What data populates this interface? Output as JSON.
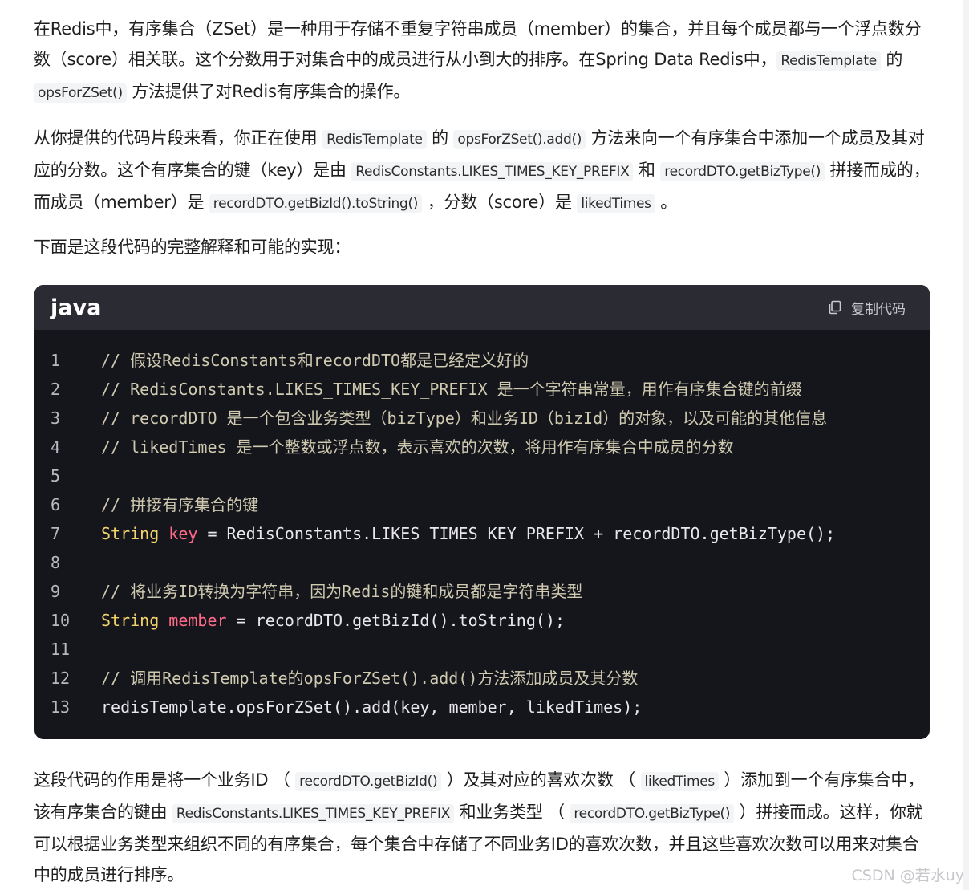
{
  "intro": {
    "p1": {
      "t1": "在Redis中，有序集合（ZSet）是一种用于存储不重复字符串成员（member）的集合，并且每个成员都与一个浮点数分数（score）相关联。这个分数用于对集合中的成员进行从小到大的排序。在Spring Data Redis中，",
      "c1": "RedisTemplate",
      "t2": " 的 ",
      "c2": "opsForZSet()",
      "t3": " 方法提供了对Redis有序集合的操作。"
    },
    "p2": {
      "t1": "从你提供的代码片段来看，你正在使用 ",
      "c1": "RedisTemplate",
      "t2": " 的 ",
      "c2": "opsForZSet().add()",
      "t3": " 方法来向一个有序集合中添加一个成员及其对应的分数。这个有序集合的键（key）是由 ",
      "c3": "RedisConstants.LIKES_TIMES_KEY_PREFIX",
      "t4": " 和 ",
      "c4": "recordDTO.getBizType()",
      "t5": " 拼接而成的，而成员（member）是 ",
      "c5": "recordDTO.getBizId().toString()",
      "t6": " ，分数（score）是 ",
      "c6": "likedTimes",
      "t7": " 。"
    },
    "p3": "下面是这段代码的完整解释和可能的实现："
  },
  "code_block": {
    "language": "java",
    "copy_label": "复制代码",
    "lines": [
      {
        "n": "1",
        "cm": "// 假设RedisConstants和recordDTO都是已经定义好的"
      },
      {
        "n": "2",
        "cm": "// RedisConstants.LIKES_TIMES_KEY_PREFIX 是一个字符串常量，用作有序集合键的前缀"
      },
      {
        "n": "3",
        "cm": "// recordDTO 是一个包含业务类型（bizType）和业务ID（bizId）的对象，以及可能的其他信息"
      },
      {
        "n": "4",
        "cm": "// likedTimes 是一个整数或浮点数，表示喜欢的次数，将用作有序集合中成员的分数"
      },
      {
        "n": "5"
      },
      {
        "n": "6",
        "cm": "// 拼接有序集合的键"
      },
      {
        "n": "7",
        "ty": "String",
        "vr": "key",
        "rest": " = RedisConstants.LIKES_TIMES_KEY_PREFIX + recordDTO.getBizType();"
      },
      {
        "n": "8"
      },
      {
        "n": "9",
        "cm": "// 将业务ID转换为字符串，因为Redis的键和成员都是字符串类型"
      },
      {
        "n": "10",
        "ty": "String",
        "vr": "member",
        "rest": " = recordDTO.getBizId().toString();"
      },
      {
        "n": "11"
      },
      {
        "n": "12",
        "cm": "// 调用RedisTemplate的opsForZSet().add()方法添加成员及其分数"
      },
      {
        "n": "13",
        "rest": "redisTemplate.opsForZSet().add(key, member, likedTimes);"
      }
    ]
  },
  "outro": {
    "t1": "这段代码的作用是将一个业务ID （ ",
    "c1": "recordDTO.getBizId()",
    "t2": " ）及其对应的喜欢次数 （ ",
    "c2": "likedTimes",
    "t3": " ）添加到一个有序集合中，该有序集合的键由 ",
    "c3": "RedisConstants.LIKES_TIMES_KEY_PREFIX",
    "t4": " 和业务类型 （ ",
    "c4": "recordDTO.getBizType()",
    "t5": " ）拼接而成。这样，你就可以根据业务类型来组织不同的有序集合，每个集合中存储了不同业务ID的喜欢次数，并且这些喜欢次数可以用来对集合中的成员进行排序。"
  },
  "watermark": "CSDN @若水uy"
}
